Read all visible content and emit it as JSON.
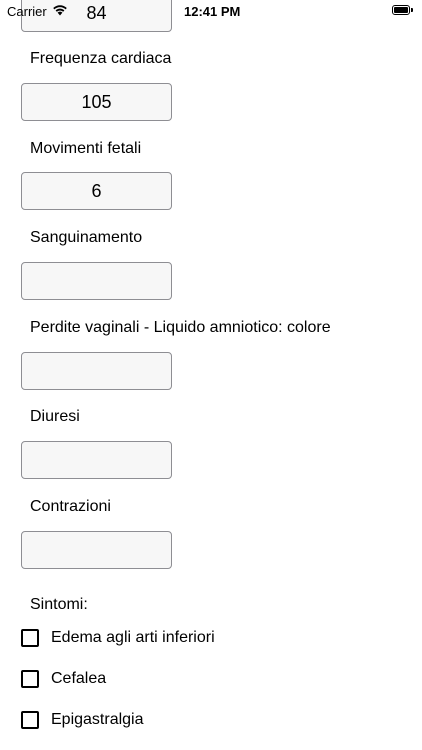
{
  "status_bar": {
    "carrier": "Carrier",
    "time": "12:41 PM",
    "wifi_icon": "wifi-icon",
    "battery_icon": "battery-icon"
  },
  "form": {
    "top_field_value": "84",
    "fields": [
      {
        "label": "Frequenza cardiaca",
        "value": "105"
      },
      {
        "label": "Movimenti fetali",
        "value": "6"
      },
      {
        "label": "Sanguinamento",
        "value": ""
      },
      {
        "label": "Perdite vaginali - Liquido amniotico: colore",
        "value": ""
      },
      {
        "label": "Diuresi",
        "value": ""
      },
      {
        "label": "Contrazioni",
        "value": ""
      }
    ],
    "symptoms_label": "Sintomi:",
    "symptoms": [
      {
        "label": "Edema agli arti inferiori",
        "checked": false
      },
      {
        "label": "Cefalea",
        "checked": false
      },
      {
        "label": "Epigastralgia",
        "checked": false
      }
    ]
  }
}
